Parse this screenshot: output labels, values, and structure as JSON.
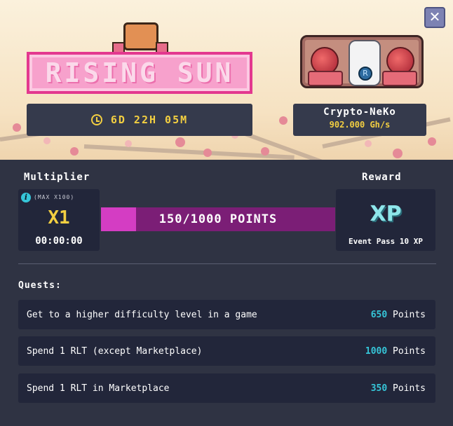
{
  "event": {
    "title": "RISING SUN",
    "time_left": "6D 22H 05M"
  },
  "miner": {
    "name": "Crypto-NeKo",
    "power": "902.000 Gh/s",
    "coin_letter": "R"
  },
  "multiplier": {
    "label": "Multiplier",
    "max_note": "(MAX X100)",
    "value": "X1",
    "timer": "00:00:00"
  },
  "progress": {
    "text": "150/1000 POINTS",
    "current": 150,
    "max": 1000
  },
  "reward": {
    "label": "Reward",
    "value": "XP",
    "description": "Event Pass 10 XP"
  },
  "quests": {
    "label": "Quests:",
    "points_label": "Points",
    "items": [
      {
        "text": "Get to a higher difficulty level in a game",
        "points": "650"
      },
      {
        "text": "Spend 1 RLT (except Marketplace)",
        "points": "1000"
      },
      {
        "text": "Spend 1 RLT in Marketplace",
        "points": "350"
      }
    ]
  },
  "colors": {
    "accent_pink": "#e3388f",
    "accent_yellow": "#f3cf41",
    "accent_cyan": "#36c5d8",
    "panel_bg": "#2f3343"
  },
  "icons": {
    "close": "close-icon",
    "clock": "clock-icon",
    "info": "info-icon"
  }
}
